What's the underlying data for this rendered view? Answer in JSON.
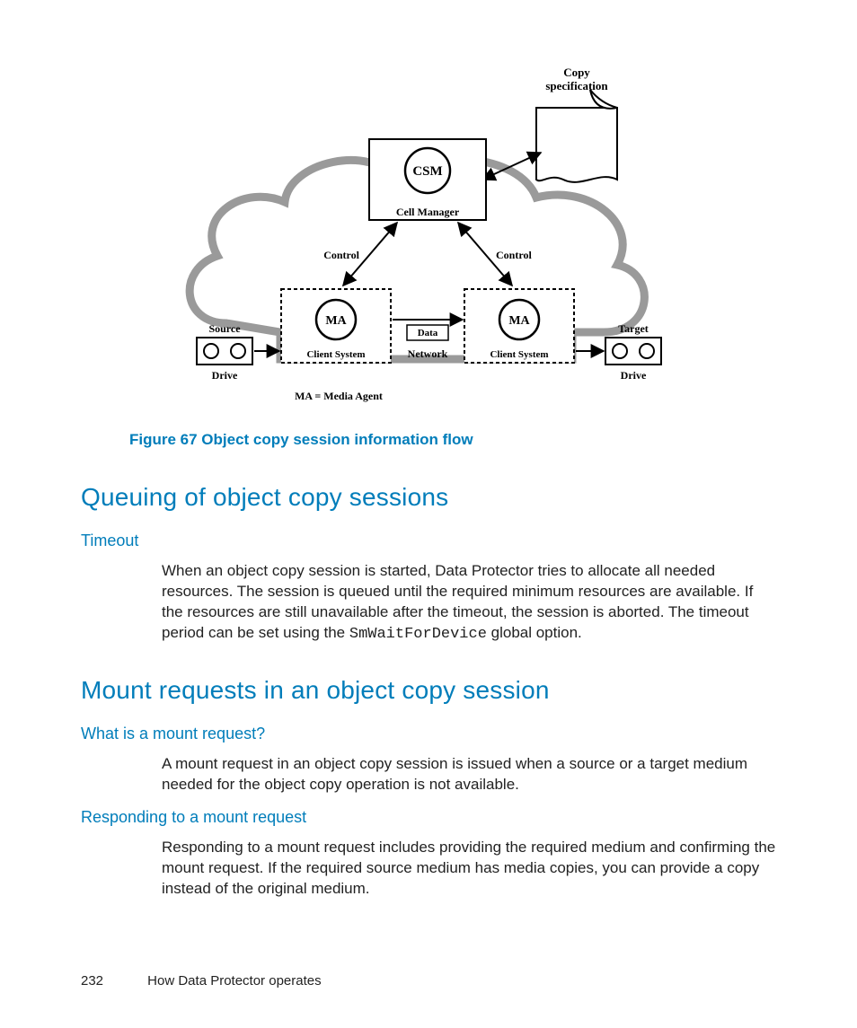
{
  "figure": {
    "caption": "Figure 67 Object copy session information flow",
    "labels": {
      "copy_spec": "Copy specification",
      "csm": "CSM",
      "cell_manager": "Cell Manager",
      "control_left": "Control",
      "control_right": "Control",
      "ma_left": "MA",
      "ma_right": "MA",
      "client_left": "Client System",
      "client_right": "Client System",
      "data": "Data",
      "network": "Network",
      "source": "Source",
      "target": "Target",
      "drive_left": "Drive",
      "drive_right": "Drive",
      "legend": "MA = Media Agent"
    }
  },
  "section1": {
    "title": "Queuing of object copy sessions",
    "sub1": {
      "title": "Timeout",
      "para_a": "When an object copy session is started, Data Protector tries to allocate all needed resources. The session is queued until the required minimum resources are available. If the resources are still unavailable after the timeout, the session is aborted. The timeout period can be set using the ",
      "code": "SmWaitForDevice",
      "para_b": " global option."
    }
  },
  "section2": {
    "title": "Mount requests in an object copy session",
    "sub1": {
      "title": "What is a mount request?",
      "para": "A mount request in an object copy session is issued when a source or a target medium needed for the object copy operation is not available."
    },
    "sub2": {
      "title": "Responding to a mount request",
      "para": "Responding to a mount request includes providing the required medium and confirming the mount request. If the required source medium has media copies, you can provide a copy instead of the original medium."
    }
  },
  "footer": {
    "page": "232",
    "chapter": "How Data Protector operates"
  }
}
